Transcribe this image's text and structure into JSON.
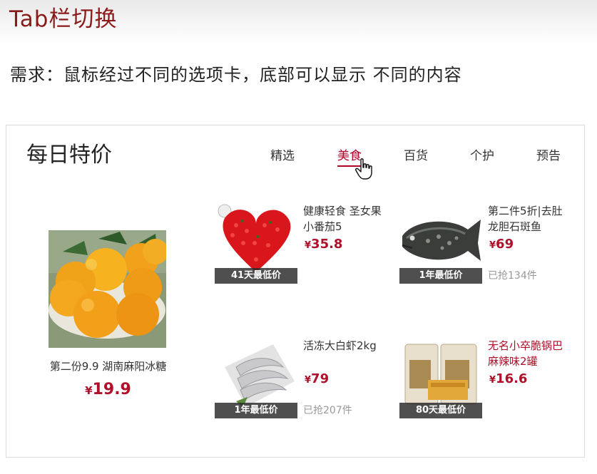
{
  "header": {
    "title": "Tab栏切换",
    "requirement": "需求：鼠标经过不同的选项卡，底部可以显示 不同的内容"
  },
  "card": {
    "title": "每日特价",
    "tabs": [
      {
        "label": "精选",
        "active": false
      },
      {
        "label": "美食",
        "active": true
      },
      {
        "label": "百货",
        "active": false
      },
      {
        "label": "个护",
        "active": false
      },
      {
        "label": "预告",
        "active": false
      }
    ],
    "featured": {
      "name": "第二份9.9 湖南麻阳冰糖",
      "currency": "¥",
      "price": "19.9",
      "image": "oranges"
    },
    "products": [
      {
        "name": "健康轻食 圣女果小番茄5",
        "currency": "¥",
        "price": "35.8",
        "badge": "41天最低价",
        "sold": "",
        "image": "tomatoes"
      },
      {
        "name": "第二件5折|去肚龙胆石斑鱼",
        "currency": "¥",
        "price": "69",
        "badge": "1年最低价",
        "sold": "已抢134件",
        "image": "grouper-fish"
      },
      {
        "name": "活冻大白虾2kg",
        "currency": "¥",
        "price": "79",
        "badge": "1年最低价",
        "sold": "已抢207件",
        "image": "shrimp"
      },
      {
        "name": "无名小卒脆锅巴麻辣味2罐",
        "currency": "¥",
        "price": "16.6",
        "badge": "80天最低价",
        "sold": "",
        "image": "rice-crackers"
      }
    ]
  },
  "colors": {
    "title_red": "#8b1a1a",
    "price_red": "#b0102a",
    "active_tab": "#b0002a"
  }
}
